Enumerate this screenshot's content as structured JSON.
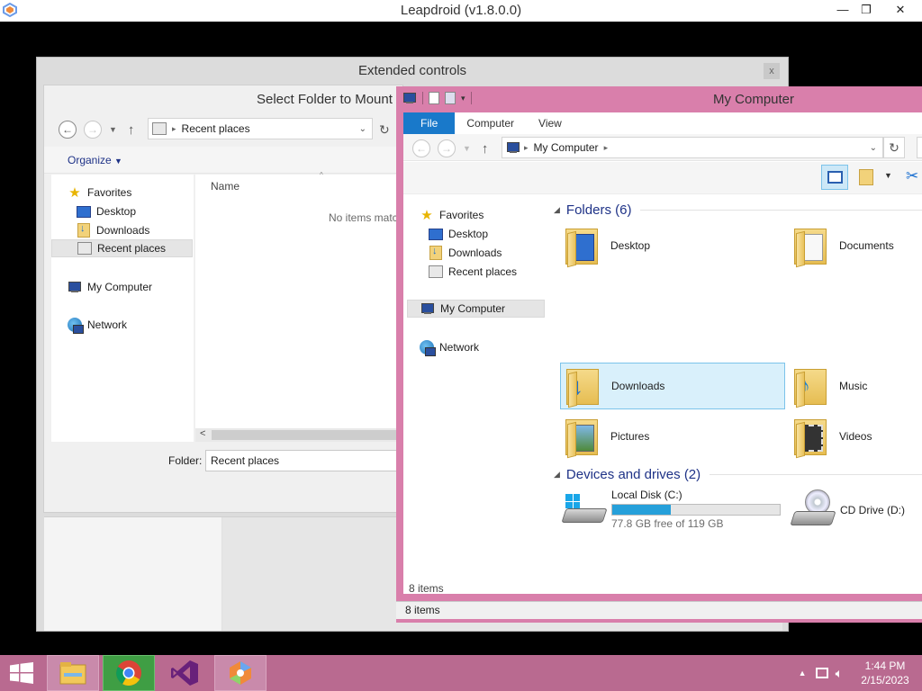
{
  "app": {
    "title": "Leapdroid (v1.8.0.0)",
    "minimize": "—",
    "restore": "❐",
    "close": "✕"
  },
  "extended_controls": {
    "title": "Extended controls",
    "close": "x"
  },
  "select_folder": {
    "title": "Select Folder to Mount",
    "address": "Recent places",
    "organize": "Organize",
    "column_name": "Name",
    "empty_text": "No items match your search.",
    "folder_label": "Folder:",
    "folder_value": "Recent places",
    "nav": [
      "Favorites",
      "Desktop",
      "Downloads",
      "Recent places",
      "My Computer",
      "Network"
    ]
  },
  "my_computer": {
    "title": "My Computer",
    "tabs": [
      "File",
      "Computer",
      "View"
    ],
    "address": "My Computer",
    "nav": [
      "Favorites",
      "Desktop",
      "Downloads",
      "Recent places",
      "My Computer",
      "Network"
    ],
    "folders_group": "Folders (6)",
    "folders": [
      "Desktop",
      "Documents",
      "Downloads",
      "Music",
      "Pictures",
      "Videos"
    ],
    "devices_group": "Devices and drives (2)",
    "drives": [
      {
        "name": "Local Disk (C:)",
        "free": "77.8 GB free of 119 GB",
        "used_fraction": 0.35
      },
      {
        "name": "CD Drive (D:)"
      }
    ],
    "item_count": "8 items",
    "status": "8 items"
  },
  "taskbar": {
    "time": "1:44 PM",
    "date": "2/15/2023"
  },
  "colors": {
    "accent": "#1979ca",
    "window_frame": "#d97fab",
    "taskbar": "#b96a90",
    "drive_bar": "#26a0da"
  }
}
